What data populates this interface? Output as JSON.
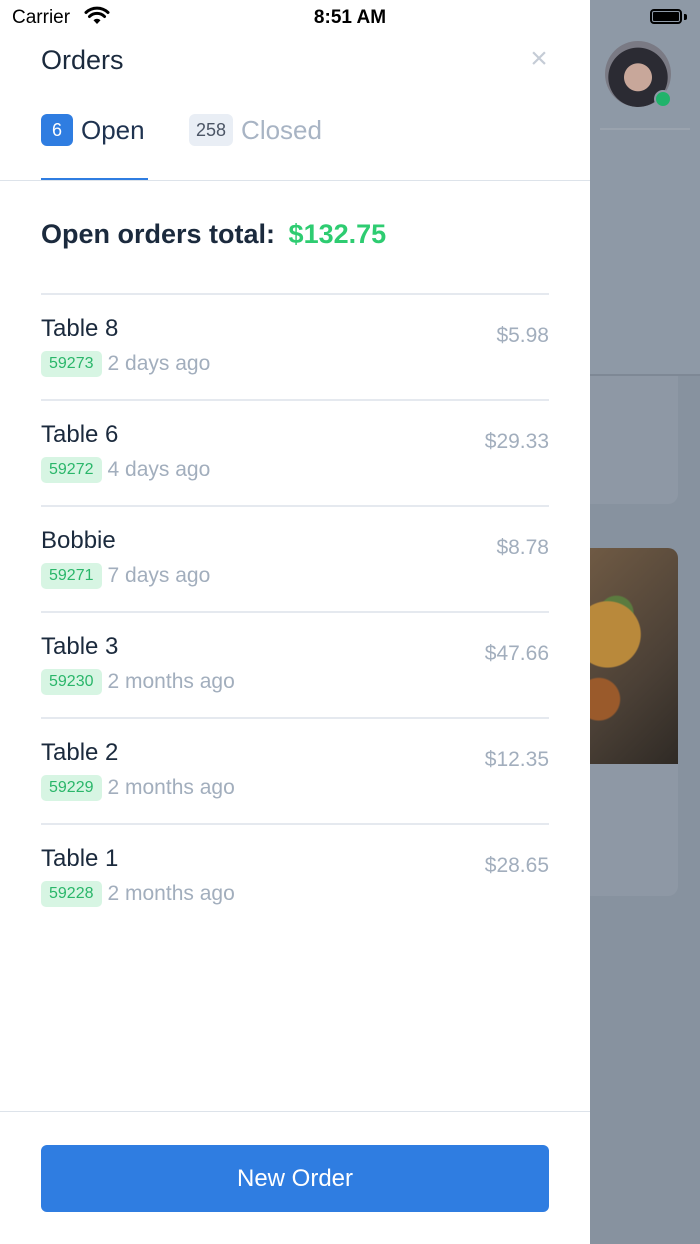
{
  "status_bar": {
    "carrier": "Carrier",
    "time": "8:51 AM"
  },
  "drawer": {
    "title": "Orders",
    "close_icon": "close-icon",
    "tabs": [
      {
        "count": "6",
        "label": "Open",
        "active": true
      },
      {
        "count": "258",
        "label": "Closed",
        "active": false
      }
    ],
    "total": {
      "label": "Open orders total:",
      "amount": "$132.75"
    },
    "orders": [
      {
        "name": "Table 8",
        "id": "59273",
        "time": "2 days ago",
        "amount": "$5.98"
      },
      {
        "name": "Table 6",
        "id": "59272",
        "time": "4 days ago",
        "amount": "$29.33"
      },
      {
        "name": "Bobbie",
        "id": "59271",
        "time": "7 days ago",
        "amount": "$8.78"
      },
      {
        "name": "Table 3",
        "id": "59230",
        "time": "2 months ago",
        "amount": "$47.66"
      },
      {
        "name": "Table 2",
        "id": "59229",
        "time": "2 months ago",
        "amount": "$12.35"
      },
      {
        "name": "Table 1",
        "id": "59228",
        "time": "2 months ago",
        "amount": "$28.65"
      }
    ],
    "new_order_label": "New Order"
  },
  "colors": {
    "accent": "#2f7de1",
    "success": "#2ecc71",
    "text": "#1b2a3d",
    "muted": "#a2aebd"
  }
}
